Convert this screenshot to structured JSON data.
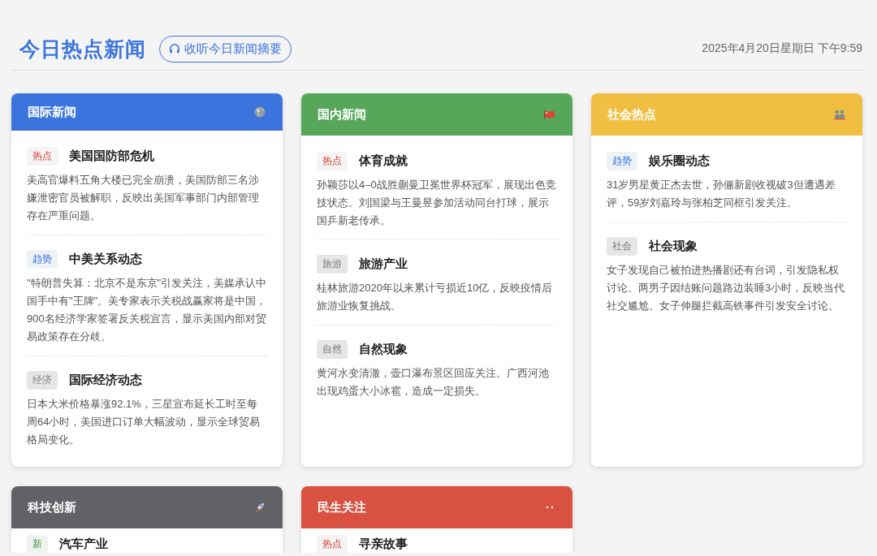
{
  "header": {
    "title": "今日热点新闻",
    "listen_button": "收听今日新闻摘要",
    "datetime": "2025年4月20日星期日 下午9:59"
  },
  "sections": [
    {
      "title": "国际新闻",
      "color": "#3b74dc",
      "items": [
        {
          "tag": "热点",
          "kind": "hot",
          "title": "美国国防部危机",
          "text": "美高官爆料五角大楼已完全崩溃，美国防部三名涉嫌泄密官员被解职，反映出美国军事部门内部管理存在严重问题。"
        },
        {
          "tag": "趋势",
          "kind": "trend",
          "title": "中美关系动态",
          "text": "\"特朗普失算：北京不是东京\"引发关注，美媒承认中国手中有\"王牌\"。美专家表示关税战赢家将是中国，900名经济学家签署反关税宣言，显示美国内部对贸易政策存在分歧。"
        },
        {
          "tag": "经济",
          "kind": "plain",
          "title": "国际经济动态",
          "text": "日本大米价格暴涨92.1%，三星宣布延长工时至每周64小时，美国进口订单大幅波动，显示全球贸易格局变化。"
        }
      ]
    },
    {
      "title": "国内新闻",
      "color": "#57a75b",
      "items": [
        {
          "tag": "热点",
          "kind": "hot",
          "title": "体育成就",
          "text": "孙颖莎以4–0战胜蒯曼卫冕世界杯冠军，展现出色竞技状态。刘国梁与王曼昱参加活动同台打球，展示国乒新老传承。"
        },
        {
          "tag": "旅游",
          "kind": "plain",
          "title": "旅游产业",
          "text": "桂林旅游2020年以来累计亏损近10亿，反映疫情后旅游业恢复挑战。"
        },
        {
          "tag": "自然",
          "kind": "plain",
          "title": "自然现象",
          "text": "黄河水变清澈，壶口瀑布景区回应关注。广西河池出现鸡蛋大小冰雹，造成一定损失。"
        }
      ]
    },
    {
      "title": "社会热点",
      "color": "#f0bf42",
      "items": [
        {
          "tag": "趋势",
          "kind": "trend",
          "title": "娱乐圈动态",
          "text": "31岁男星黄正杰去世，孙俪新剧收视破3但遭遇差评，59岁刘嘉玲与张柏芝同框引发关注。"
        },
        {
          "tag": "社会",
          "kind": "plain",
          "title": "社会现象",
          "text": "女子发现自己被拍进热播剧还有台词，引发隐私权讨论。两男子因结账问题路边装睡3小时，反映当代社交尴尬。女子伸腿拦截高铁事件引发安全讨论。"
        }
      ]
    },
    {
      "title": "科技创新",
      "color": "#616266",
      "items": [
        {
          "tag": "新",
          "kind": "new",
          "title": "汽车产业"
        }
      ]
    },
    {
      "title": "民生关注",
      "color": "#d95140",
      "items": [
        {
          "tag": "热点",
          "kind": "hot",
          "title": "寻亲故事"
        }
      ]
    }
  ]
}
